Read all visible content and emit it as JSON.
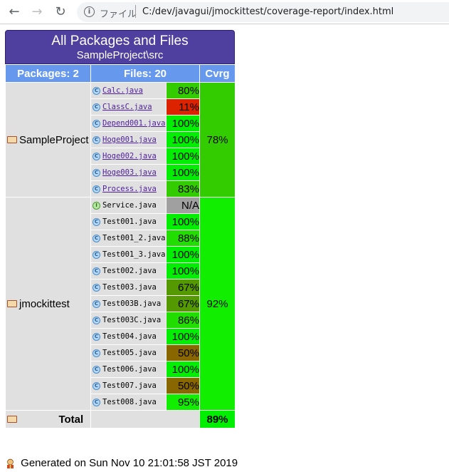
{
  "browser": {
    "back_icon": "←",
    "forward_icon": "→",
    "reload_icon": "↻",
    "info_icon": "i",
    "url_label": "ファイル",
    "url": "C:/dev/javagui/jmockittest/coverage-report/index.html"
  },
  "report": {
    "title": "All Packages and Files",
    "subtitle": "SampleProject\\src",
    "headers": {
      "packages": "Packages: 2",
      "files": "Files: 20",
      "coverage": "Cvrg"
    },
    "packages": [
      {
        "name": "SampleProject",
        "coverage": "78%",
        "coverage_color": "#33cc00",
        "files": [
          {
            "icon": "C",
            "name": "Calc.java",
            "link": true,
            "pct": "80%",
            "color": "#33cc00"
          },
          {
            "icon": "C",
            "name": "ClassC.java",
            "link": true,
            "pct": "11%",
            "color": "#dd2200"
          },
          {
            "icon": "C",
            "name": "Depend001.java",
            "link": true,
            "pct": "100%",
            "color": "#00ee00"
          },
          {
            "icon": "C",
            "name": "Hoge001.java",
            "link": true,
            "pct": "100%",
            "color": "#00ee00"
          },
          {
            "icon": "C",
            "name": "Hoge002.java",
            "link": true,
            "pct": "100%",
            "color": "#00ee00"
          },
          {
            "icon": "C",
            "name": "Hoge003.java",
            "link": true,
            "pct": "100%",
            "color": "#00ee00"
          },
          {
            "icon": "C",
            "name": "Process.java",
            "link": true,
            "pct": "83%",
            "color": "#33cc00"
          }
        ]
      },
      {
        "name": "jmockittest",
        "coverage": "92%",
        "coverage_color": "#11ee00",
        "files": [
          {
            "icon": "I",
            "name": "Service.java",
            "link": false,
            "pct": "N/A",
            "color": "#a0a0a0"
          },
          {
            "icon": "C",
            "name": "Test001.java",
            "link": false,
            "pct": "100%",
            "color": "#00ee00"
          },
          {
            "icon": "C",
            "name": "Test001_2.java",
            "link": false,
            "pct": "88%",
            "color": "#22dd00"
          },
          {
            "icon": "C",
            "name": "Test001_3.java",
            "link": false,
            "pct": "100%",
            "color": "#00ee00"
          },
          {
            "icon": "C",
            "name": "Test002.java",
            "link": false,
            "pct": "100%",
            "color": "#00ee00"
          },
          {
            "icon": "C",
            "name": "Test003.java",
            "link": false,
            "pct": "67%",
            "color": "#559900"
          },
          {
            "icon": "C",
            "name": "Test003B.java",
            "link": false,
            "pct": "67%",
            "color": "#559900"
          },
          {
            "icon": "C",
            "name": "Test003C.java",
            "link": false,
            "pct": "86%",
            "color": "#22dd00"
          },
          {
            "icon": "C",
            "name": "Test004.java",
            "link": false,
            "pct": "100%",
            "color": "#00ee00"
          },
          {
            "icon": "C",
            "name": "Test005.java",
            "link": false,
            "pct": "50%",
            "color": "#886600"
          },
          {
            "icon": "C",
            "name": "Test006.java",
            "link": false,
            "pct": "100%",
            "color": "#00ee00"
          },
          {
            "icon": "C",
            "name": "Test007.java",
            "link": false,
            "pct": "50%",
            "color": "#886600"
          },
          {
            "icon": "C",
            "name": "Test008.java",
            "link": false,
            "pct": "95%",
            "color": "#11ee00"
          }
        ]
      }
    ],
    "total": {
      "label": "Total",
      "value": "89%"
    }
  },
  "footer": {
    "icon": "generator-icon",
    "text": "Generated on Sun Nov 10 21:01:58 JST 2019"
  }
}
